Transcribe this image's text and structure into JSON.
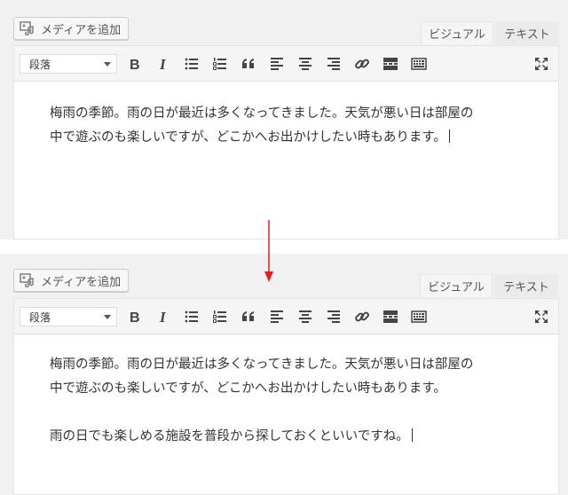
{
  "editor": {
    "media_button_label": "メディアを追加",
    "tab_visual": "ビジュアル",
    "tab_text": "テキスト",
    "format_select_value": "段落",
    "toolbar_icons": [
      "bold-icon",
      "italic-icon",
      "bulleted-list-icon",
      "numbered-list-icon",
      "blockquote-icon",
      "align-left-icon",
      "align-center-icon",
      "align-right-icon",
      "link-icon",
      "read-more-icon",
      "toolbar-toggle-icon",
      "fullscreen-icon"
    ]
  },
  "before": {
    "paragraphs": [
      [
        "梅雨の季節。雨の日が最近は多くなってきました。天気が悪い日は部屋の",
        "中で遊ぶのも楽しいですが、どこかへお出かけしたい時もあります。"
      ]
    ]
  },
  "after": {
    "paragraphs": [
      [
        "梅雨の季節。雨の日が最近は多くなってきました。天気が悪い日は部屋の",
        "中で遊ぶのも楽しいですが、どこかへお出かけしたい時もあります。"
      ],
      [
        "雨の日でも楽しめる施設を普段から探しておくといいですね。"
      ]
    ]
  },
  "colors": {
    "arrow": "#e02020",
    "panel_bg": "#f1f1f1",
    "toolbar_bg": "#f5f5f5"
  }
}
